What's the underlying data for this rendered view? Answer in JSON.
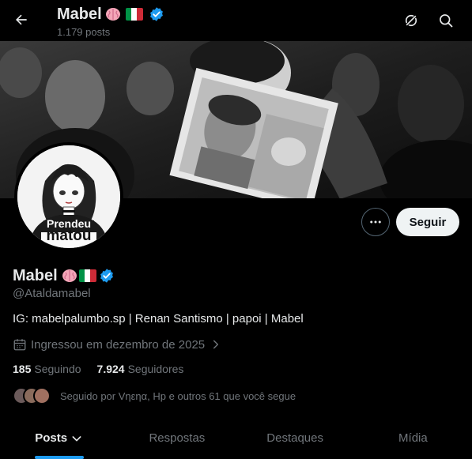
{
  "header": {
    "name": "Mabel",
    "posts_count": "1.179 posts"
  },
  "profile": {
    "name": "Mabel",
    "handle": "@Ataldamabel",
    "bio": "IG: mabelpalumbo.sp | Renan Santismo | papoi | Mabel",
    "joined": "Ingressou em dezembro de 2025",
    "following_count": "185",
    "following_label": "Seguindo",
    "followers_count": "7.924",
    "followers_label": "Seguidores",
    "followed_by": "Seguido por Vηεηα, Hp e outros 61 que você segue",
    "avatar_shirt_text_1": "Prendeu",
    "avatar_shirt_text_2": "matou"
  },
  "actions": {
    "follow_label": "Seguir"
  },
  "tabs": [
    {
      "label": "Posts",
      "active": true
    },
    {
      "label": "Respostas",
      "active": false
    },
    {
      "label": "Destaques",
      "active": false
    },
    {
      "label": "Mídia",
      "active": false
    }
  ],
  "icons": {
    "back": "arrow-left-icon",
    "grok": "grok-icon",
    "search": "search-icon",
    "verified": "verified-badge-icon",
    "brain": "brain-emoji-icon",
    "flag": "italy-flag-icon",
    "calendar": "calendar-icon",
    "more": "more-horizontal-icon"
  },
  "colors": {
    "background": "#000000",
    "text_primary": "#e7e9ea",
    "text_secondary": "#71767b",
    "accent": "#1d9bf0",
    "follow_button_bg": "#eff3f4"
  }
}
